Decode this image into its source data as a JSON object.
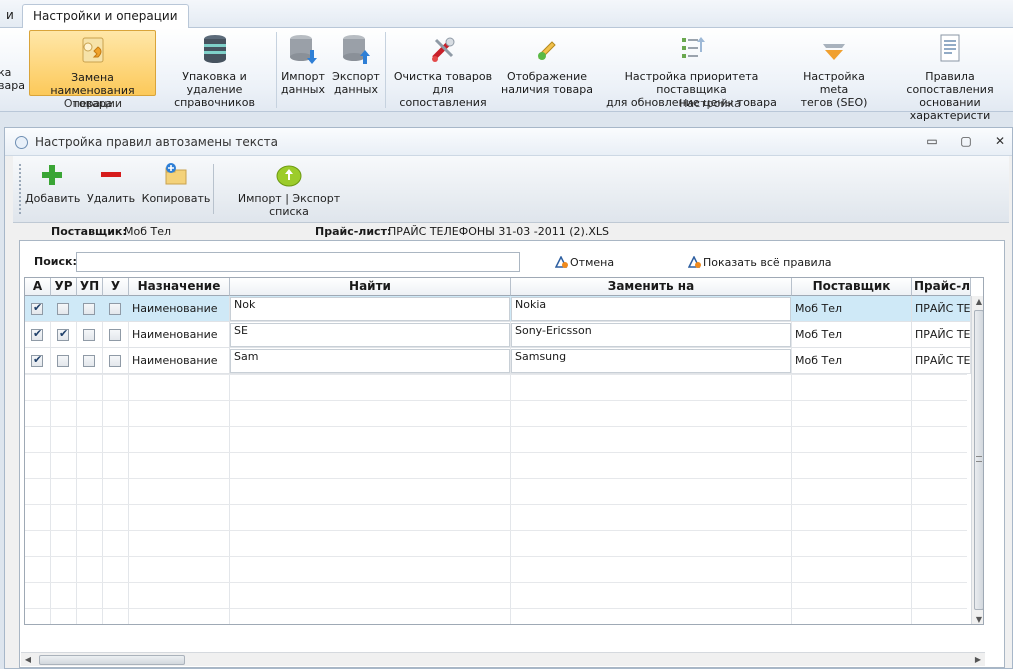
{
  "ribbon": {
    "tabs": [
      "и",
      "Настройки и операции"
    ],
    "buttons": {
      "partial_line1": "ка",
      "partial_line2": "вара",
      "rename_line1": "Замена наименования",
      "rename_line2": "товара",
      "packing_line1": "Упаковка и удаление",
      "packing_line2": "справочников",
      "import_line1": "Импорт",
      "import_line2": "данных",
      "export_line1": "Экспорт",
      "export_line2": "данных",
      "clean_line1": "Очистка товаров",
      "clean_line2": "для сопоставления",
      "display_line1": "Отображение",
      "display_line2": "наличия товара",
      "priority_line1": "Настройка приоритета поставщика",
      "priority_line2": "для обновление цены товара",
      "meta_line1": "Настройка meta",
      "meta_line2": "тегов (SEO)",
      "rules_line1": "Правила сопоставления",
      "rules_line2": "основании характеристи"
    },
    "groups": {
      "operations": "Операции",
      "settings": "Настройка"
    }
  },
  "window": {
    "title": "Настройка правил автозамены текста",
    "controls": {
      "minimize": "▭",
      "maximize": "▢",
      "close": "✕"
    }
  },
  "toolbar": {
    "add": "Добавить",
    "delete": "Удалить",
    "copy": "Копировать",
    "import_export": "Импорт | Экспорт списка"
  },
  "info": {
    "supplier_label": "Поставщик:",
    "supplier_value": "Моб Тел",
    "pricelist_label": "Прайс-лист:",
    "pricelist_value": "ПРАЙС ТЕЛЕФОНЫ 31-03 -2011 (2).XLS"
  },
  "search": {
    "label": "Поиск:",
    "value": "",
    "cancel": "Отмена",
    "show_all": "Показать всё правила"
  },
  "grid": {
    "columns": [
      "А",
      "УР",
      "УП",
      "У",
      "Назначение",
      "Найти",
      "Заменить на",
      "Поставщик",
      "Прайс-ли"
    ],
    "rows": [
      {
        "a": true,
        "ur": false,
        "up": false,
        "u": false,
        "purpose": "Наименование",
        "find": "Nok",
        "replace": "Nokia",
        "supplier": "Моб Тел",
        "pricelist": "ПРАЙС ТЕЛЕ"
      },
      {
        "a": true,
        "ur": true,
        "up": false,
        "u": false,
        "purpose": "Наименование",
        "find": "SE",
        "replace": "Sony-Ericsson",
        "supplier": "Моб Тел",
        "pricelist": "ПРАЙС ТЕЛЕ"
      },
      {
        "a": true,
        "ur": false,
        "up": false,
        "u": false,
        "purpose": "Наименование",
        "find": "Sam",
        "replace": "Samsung",
        "supplier": "Моб Тел",
        "pricelist": "ПРАЙС ТЕЛЕ"
      }
    ]
  },
  "colors": {
    "selected_row": "#cfe9f7",
    "ribbon_selected": "#fcc95a",
    "add_icon": "#3aa535",
    "delete_icon": "#d61c1c",
    "import_export_icon": "#9ccc2a"
  }
}
